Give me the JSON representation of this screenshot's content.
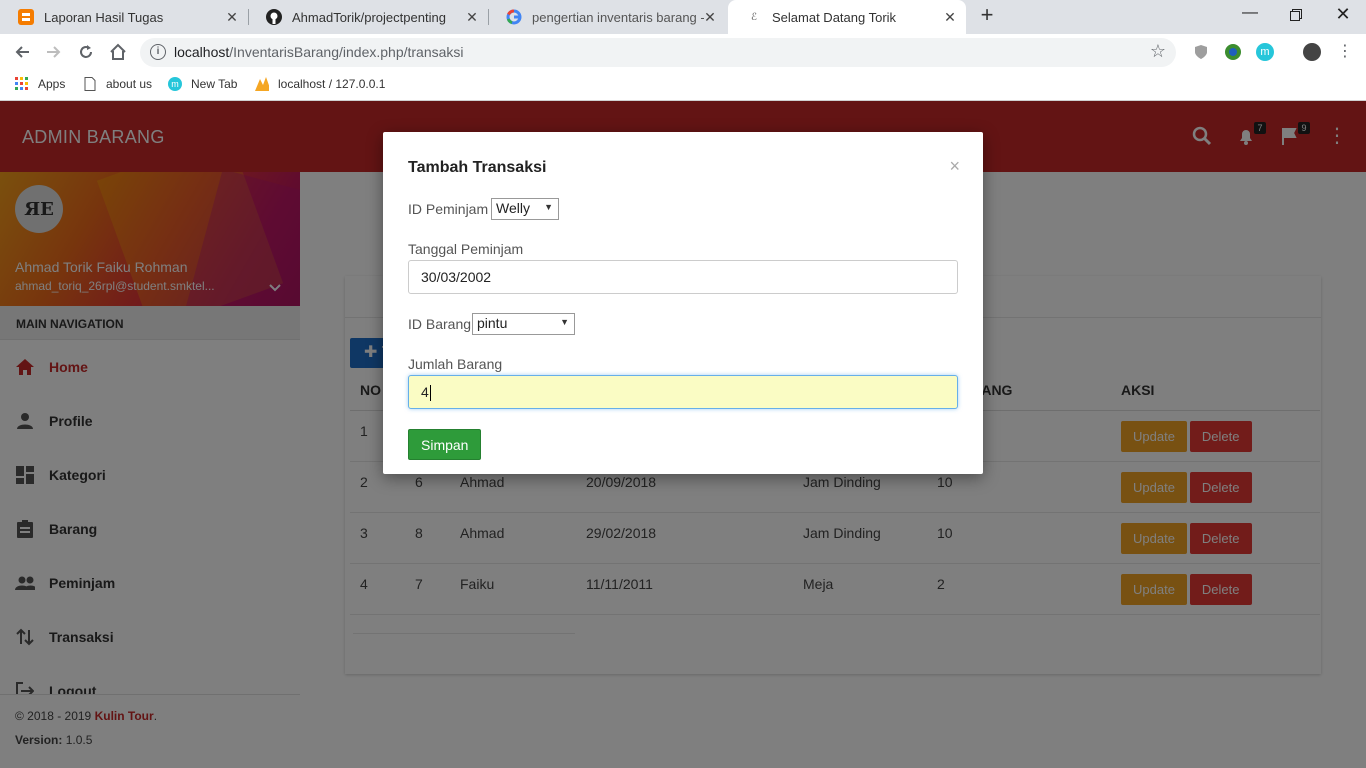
{
  "browser": {
    "tabs": [
      {
        "label": "Laporan Hasil Tugas",
        "icon": "blogger-icon"
      },
      {
        "label": "AhmadTorik/projectpenting",
        "icon": "github-icon"
      },
      {
        "label": "pengertian inventaris barang - G",
        "icon": "google-icon"
      },
      {
        "label": "Selamat Datang Torik",
        "icon": "page-icon"
      }
    ],
    "url_host": "localhost",
    "url_path": "/InventarisBarang/index.php/transaksi",
    "bookmarks": [
      "Apps",
      "about us",
      "New Tab",
      "localhost / 127.0.0.1"
    ]
  },
  "header": {
    "brand": "ADMIN BARANG",
    "notifications_count": "7",
    "flags_count": "9"
  },
  "sidebar": {
    "avatar_text": "ЯE",
    "user_name": "Ahmad Torik Faiku Rohman",
    "user_email": "ahmad_toriq_26rpl@student.smktel...",
    "nav_header": "MAIN NAVIGATION",
    "items": [
      {
        "label": "Home",
        "icon": "home-icon",
        "active": true
      },
      {
        "label": "Profile",
        "icon": "person-icon"
      },
      {
        "label": "Kategori",
        "icon": "dashboard-icon"
      },
      {
        "label": "Barang",
        "icon": "clipboard-icon"
      },
      {
        "label": "Peminjam",
        "icon": "people-icon"
      },
      {
        "label": "Transaksi",
        "icon": "swap-icon"
      },
      {
        "label": "Logout",
        "icon": "logout-icon"
      }
    ],
    "footer_copy": "© 2018 - 2019",
    "footer_brand": "Kulin Tour",
    "footer_period": ".",
    "version_label": "Version:",
    "version_value": "1.0.5"
  },
  "table": {
    "add_label": "✚ T",
    "headers": [
      "NO",
      "",
      "",
      "",
      "",
      "H BARANG",
      "AKSI"
    ],
    "rows": [
      {
        "no": "1",
        "id": "",
        "name": "",
        "date": "",
        "item": "",
        "qty": ""
      },
      {
        "no": "2",
        "id": "6",
        "name": "Ahmad",
        "date": "20/09/2018",
        "item": "Jam Dinding",
        "qty": "10"
      },
      {
        "no": "3",
        "id": "8",
        "name": "Ahmad",
        "date": "29/02/2018",
        "item": "Jam Dinding",
        "qty": "10"
      },
      {
        "no": "4",
        "id": "7",
        "name": "Faiku",
        "date": "11/11/2011",
        "item": "Meja",
        "qty": "2"
      }
    ],
    "update_label": "Update",
    "delete_label": "Delete"
  },
  "modal": {
    "title": "Tambah Transaksi",
    "close": "×",
    "id_peminjam_label": "ID Peminjam",
    "id_peminjam_value": "Welly",
    "tanggal_label": "Tanggal Peminjam",
    "tanggal_value": "30/03/2002",
    "id_barang_label": "ID Barang",
    "id_barang_value": "pintu",
    "jumlah_label": "Jumlah Barang",
    "jumlah_value": "4",
    "submit_label": "Simpan"
  },
  "colors": {
    "header": "#c62828",
    "update": "#f0a224",
    "delete": "#e53935",
    "submit": "#2e9b3a"
  }
}
